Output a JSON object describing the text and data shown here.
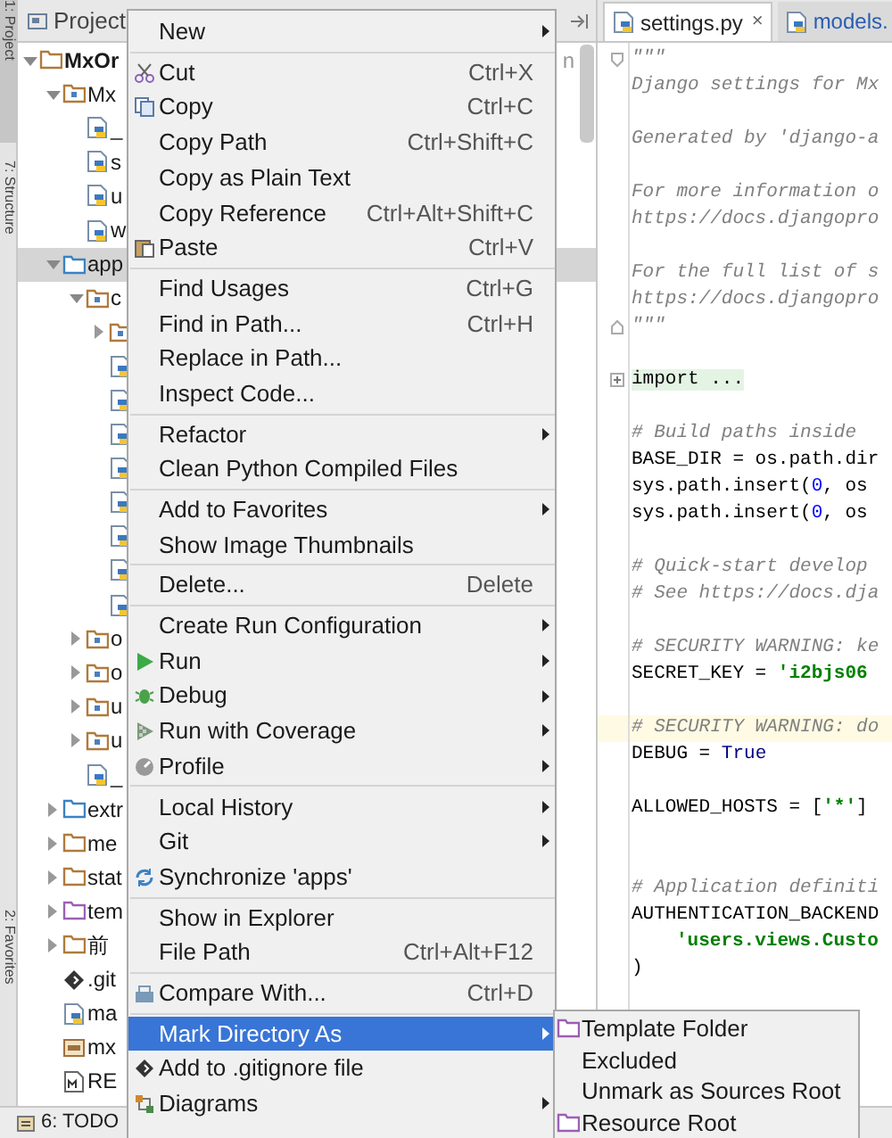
{
  "tool_strip": [
    {
      "label": "1: Project",
      "selected": true
    },
    {
      "label": "7: Structure",
      "selected": false
    },
    {
      "label": "2: Favorites",
      "selected": false
    }
  ],
  "project_panel": {
    "title": "Project",
    "tree": [
      {
        "name": "MxOr",
        "kind": "project",
        "path": "n",
        "expanded": true,
        "selected": false,
        "children": [
          {
            "name": "Mx",
            "kind": "package",
            "expanded": true,
            "selected": false,
            "children": [
              {
                "name": "_",
                "kind": "python-file",
                "selected": false
              },
              {
                "name": "s",
                "kind": "python-file",
                "selected": false
              },
              {
                "name": "u",
                "kind": "python-file",
                "selected": false
              },
              {
                "name": "w",
                "kind": "python-file",
                "selected": false
              }
            ]
          },
          {
            "name": "app",
            "kind": "source-folder",
            "expanded": true,
            "selected": true,
            "children": [
              {
                "name": "c",
                "kind": "package",
                "expanded": true,
                "selected": false,
                "children": [
                  {
                    "kind": "package",
                    "expanded": false,
                    "selected": false
                  },
                  {
                    "kind": "python-file",
                    "selected": false
                  },
                  {
                    "kind": "python-file",
                    "selected": false
                  },
                  {
                    "kind": "python-file",
                    "selected": false
                  },
                  {
                    "kind": "python-file",
                    "selected": false
                  },
                  {
                    "kind": "python-file",
                    "selected": false
                  },
                  {
                    "kind": "python-file",
                    "selected": false
                  },
                  {
                    "kind": "python-file",
                    "selected": false
                  },
                  {
                    "kind": "python-file",
                    "selected": false
                  }
                ]
              },
              {
                "name": "o",
                "kind": "package",
                "expanded": false,
                "selected": false
              },
              {
                "name": "o",
                "kind": "package",
                "expanded": false,
                "selected": false
              },
              {
                "name": "u",
                "kind": "package",
                "expanded": false,
                "selected": false
              },
              {
                "name": "u",
                "kind": "package",
                "expanded": false,
                "selected": false
              },
              {
                "name": "_",
                "kind": "python-file",
                "selected": false
              }
            ]
          },
          {
            "name": "extr",
            "kind": "source-folder",
            "expanded": false,
            "selected": false
          },
          {
            "name": "me",
            "kind": "folder",
            "expanded": false,
            "selected": false
          },
          {
            "name": "stat",
            "kind": "folder",
            "expanded": false,
            "selected": false
          },
          {
            "name": "tem",
            "kind": "template-folder",
            "expanded": false,
            "selected": false
          },
          {
            "name": "前",
            "kind": "folder",
            "expanded": false,
            "selected": false
          },
          {
            "name": ".git",
            "kind": "gitignore-file",
            "selected": false
          },
          {
            "name": "ma",
            "kind": "python-file",
            "selected": false
          },
          {
            "name": "mx",
            "kind": "database-file",
            "selected": false
          },
          {
            "name": "RE",
            "kind": "markdown-file",
            "selected": false
          }
        ]
      }
    ]
  },
  "bottom_bar": {
    "label": "6: TODO"
  },
  "editor": {
    "tabs": [
      {
        "label": "settings.py",
        "close": "×",
        "selected": true
      },
      {
        "label": "models.",
        "selected": false
      }
    ],
    "lines": [
      {
        "kind": "fold-start",
        "segments": [
          {
            "kind": "docstring",
            "text": "\"\"\""
          }
        ]
      },
      {
        "kind": "code",
        "segments": [
          {
            "kind": "docstring",
            "text": "Django settings for Mx"
          }
        ]
      },
      {
        "kind": "code"
      },
      {
        "kind": "code",
        "segments": [
          {
            "kind": "docstring",
            "text": "Generated by 'django-a"
          }
        ]
      },
      {
        "kind": "code"
      },
      {
        "kind": "code",
        "segments": [
          {
            "kind": "docstring",
            "text": "For more information o"
          }
        ]
      },
      {
        "kind": "code",
        "segments": [
          {
            "kind": "docstring",
            "text": "https://docs.djangopro"
          }
        ]
      },
      {
        "kind": "code"
      },
      {
        "kind": "code",
        "segments": [
          {
            "kind": "docstring",
            "text": "For the full list of s"
          }
        ]
      },
      {
        "kind": "code",
        "segments": [
          {
            "kind": "docstring",
            "text": "https://docs.djangopro"
          }
        ]
      },
      {
        "kind": "fold-end",
        "segments": [
          {
            "kind": "docstring",
            "text": "\"\"\""
          }
        ]
      },
      {
        "kind": "code"
      },
      {
        "kind": "folded",
        "segments": [
          {
            "kind": "folded",
            "text": "import ..."
          }
        ]
      },
      {
        "kind": "code"
      },
      {
        "kind": "code",
        "segments": [
          {
            "kind": "comment",
            "text": "# Build paths inside"
          }
        ]
      },
      {
        "kind": "code",
        "segments": [
          {
            "kind": "plain",
            "text": "BASE_DIR = os.path.dir"
          }
        ]
      },
      {
        "kind": "code",
        "segments": [
          {
            "kind": "plain",
            "text": "sys.path.insert("
          },
          {
            "kind": "number",
            "text": "0"
          },
          {
            "kind": "plain",
            "text": ", os"
          }
        ]
      },
      {
        "kind": "code",
        "segments": [
          {
            "kind": "plain",
            "text": "sys.path.insert("
          },
          {
            "kind": "number",
            "text": "0"
          },
          {
            "kind": "plain",
            "text": ", os"
          }
        ]
      },
      {
        "kind": "code"
      },
      {
        "kind": "code",
        "segments": [
          {
            "kind": "comment",
            "text": "# Quick-start develop"
          }
        ]
      },
      {
        "kind": "code",
        "segments": [
          {
            "kind": "comment",
            "text": "# See https://docs.dja"
          }
        ]
      },
      {
        "kind": "code"
      },
      {
        "kind": "code",
        "segments": [
          {
            "kind": "comment",
            "text": "# SECURITY WARNING: ke"
          }
        ]
      },
      {
        "kind": "code",
        "segments": [
          {
            "kind": "plain",
            "text": "SECRET_KEY = "
          },
          {
            "kind": "string",
            "text": "'i2bjs06"
          }
        ]
      },
      {
        "kind": "code"
      },
      {
        "kind": "caret-line",
        "segments": [
          {
            "kind": "comment",
            "text": "# SECURITY WARNING: do"
          }
        ]
      },
      {
        "kind": "code",
        "segments": [
          {
            "kind": "plain",
            "text": "DEBUG = "
          },
          {
            "kind": "keyword",
            "text": "True"
          }
        ]
      },
      {
        "kind": "code"
      },
      {
        "kind": "code",
        "segments": [
          {
            "kind": "plain",
            "text": "ALLOWED_HOSTS = ["
          },
          {
            "kind": "string",
            "text": "'*'"
          },
          {
            "kind": "plain",
            "text": "]"
          }
        ]
      },
      {
        "kind": "code"
      },
      {
        "kind": "code"
      },
      {
        "kind": "code",
        "segments": [
          {
            "kind": "comment",
            "text": "# Application definiti"
          }
        ]
      },
      {
        "kind": "code",
        "segments": [
          {
            "kind": "plain",
            "text": "AUTHENTICATION_BACKEND"
          }
        ]
      },
      {
        "kind": "indented",
        "segments": [
          {
            "kind": "string",
            "text": "'users.views.Custo"
          }
        ]
      },
      {
        "kind": "code",
        "segments": [
          {
            "kind": "plain",
            "text": ")"
          }
        ]
      }
    ]
  },
  "context_menu": {
    "items": [
      {
        "kind": "item",
        "label": "New",
        "submenu": true,
        "selected": false
      },
      {
        "kind": "separator"
      },
      {
        "kind": "item",
        "label": "Cut",
        "shortcut": "Ctrl+X",
        "submenu": false,
        "selected": false
      },
      {
        "kind": "item",
        "label": "Copy",
        "shortcut": "Ctrl+C",
        "submenu": false,
        "selected": false
      },
      {
        "kind": "item",
        "label": "Copy Path",
        "shortcut": "Ctrl+Shift+C",
        "submenu": false,
        "selected": false
      },
      {
        "kind": "item",
        "label": "Copy as Plain Text",
        "submenu": false,
        "selected": false
      },
      {
        "kind": "item",
        "label": "Copy Reference",
        "shortcut": "Ctrl+Alt+Shift+C",
        "submenu": false,
        "selected": false
      },
      {
        "kind": "item",
        "label": "Paste",
        "shortcut": "Ctrl+V",
        "submenu": false,
        "selected": false
      },
      {
        "kind": "separator"
      },
      {
        "kind": "item",
        "label": "Find Usages",
        "shortcut": "Ctrl+G",
        "submenu": false,
        "selected": false
      },
      {
        "kind": "item",
        "label": "Find in Path...",
        "shortcut": "Ctrl+H",
        "submenu": false,
        "selected": false
      },
      {
        "kind": "item",
        "label": "Replace in Path...",
        "submenu": false,
        "selected": false
      },
      {
        "kind": "item",
        "label": "Inspect Code...",
        "submenu": false,
        "selected": false
      },
      {
        "kind": "separator"
      },
      {
        "kind": "item",
        "label": "Refactor",
        "submenu": true,
        "selected": false
      },
      {
        "kind": "item",
        "label": "Clean Python Compiled Files",
        "submenu": false,
        "selected": false
      },
      {
        "kind": "separator"
      },
      {
        "kind": "item",
        "label": "Add to Favorites",
        "submenu": true,
        "selected": false
      },
      {
        "kind": "item",
        "label": "Show Image Thumbnails",
        "submenu": false,
        "selected": false
      },
      {
        "kind": "separator"
      },
      {
        "kind": "item",
        "label": "Delete...",
        "shortcut": "Delete",
        "submenu": false,
        "selected": false
      },
      {
        "kind": "separator"
      },
      {
        "kind": "item",
        "label": "Create Run Configuration",
        "submenu": true,
        "selected": false
      },
      {
        "kind": "item",
        "label": "Run",
        "submenu": true,
        "selected": false
      },
      {
        "kind": "item",
        "label": "Debug",
        "submenu": true,
        "selected": false
      },
      {
        "kind": "item",
        "label": "Run with Coverage",
        "submenu": true,
        "selected": false
      },
      {
        "kind": "item",
        "label": "Profile",
        "submenu": true,
        "selected": false
      },
      {
        "kind": "separator"
      },
      {
        "kind": "item",
        "label": "Local History",
        "submenu": true,
        "selected": false
      },
      {
        "kind": "item",
        "label": "Git",
        "submenu": true,
        "selected": false
      },
      {
        "kind": "item",
        "label": "Synchronize 'apps'",
        "submenu": false,
        "selected": false
      },
      {
        "kind": "separator"
      },
      {
        "kind": "item",
        "label": "Show in Explorer",
        "submenu": false,
        "selected": false
      },
      {
        "kind": "item",
        "label": "File Path",
        "shortcut": "Ctrl+Alt+F12",
        "submenu": false,
        "selected": false
      },
      {
        "kind": "separator"
      },
      {
        "kind": "item",
        "label": "Compare With...",
        "shortcut": "Ctrl+D",
        "submenu": false,
        "selected": false
      },
      {
        "kind": "separator"
      },
      {
        "kind": "item",
        "label": "Mark Directory As",
        "submenu": true,
        "selected": true
      },
      {
        "kind": "item",
        "label": "Add to .gitignore file",
        "submenu": false,
        "selected": false
      },
      {
        "kind": "item",
        "label": "Diagrams",
        "submenu": true,
        "selected": false
      }
    ]
  },
  "submenu": {
    "items": [
      {
        "label": "Template Folder",
        "selected": false
      },
      {
        "label": "Excluded",
        "selected": false
      },
      {
        "label": "Unmark as Sources Root",
        "selected": false
      },
      {
        "label": "Resource Root",
        "selected": false
      }
    ]
  }
}
